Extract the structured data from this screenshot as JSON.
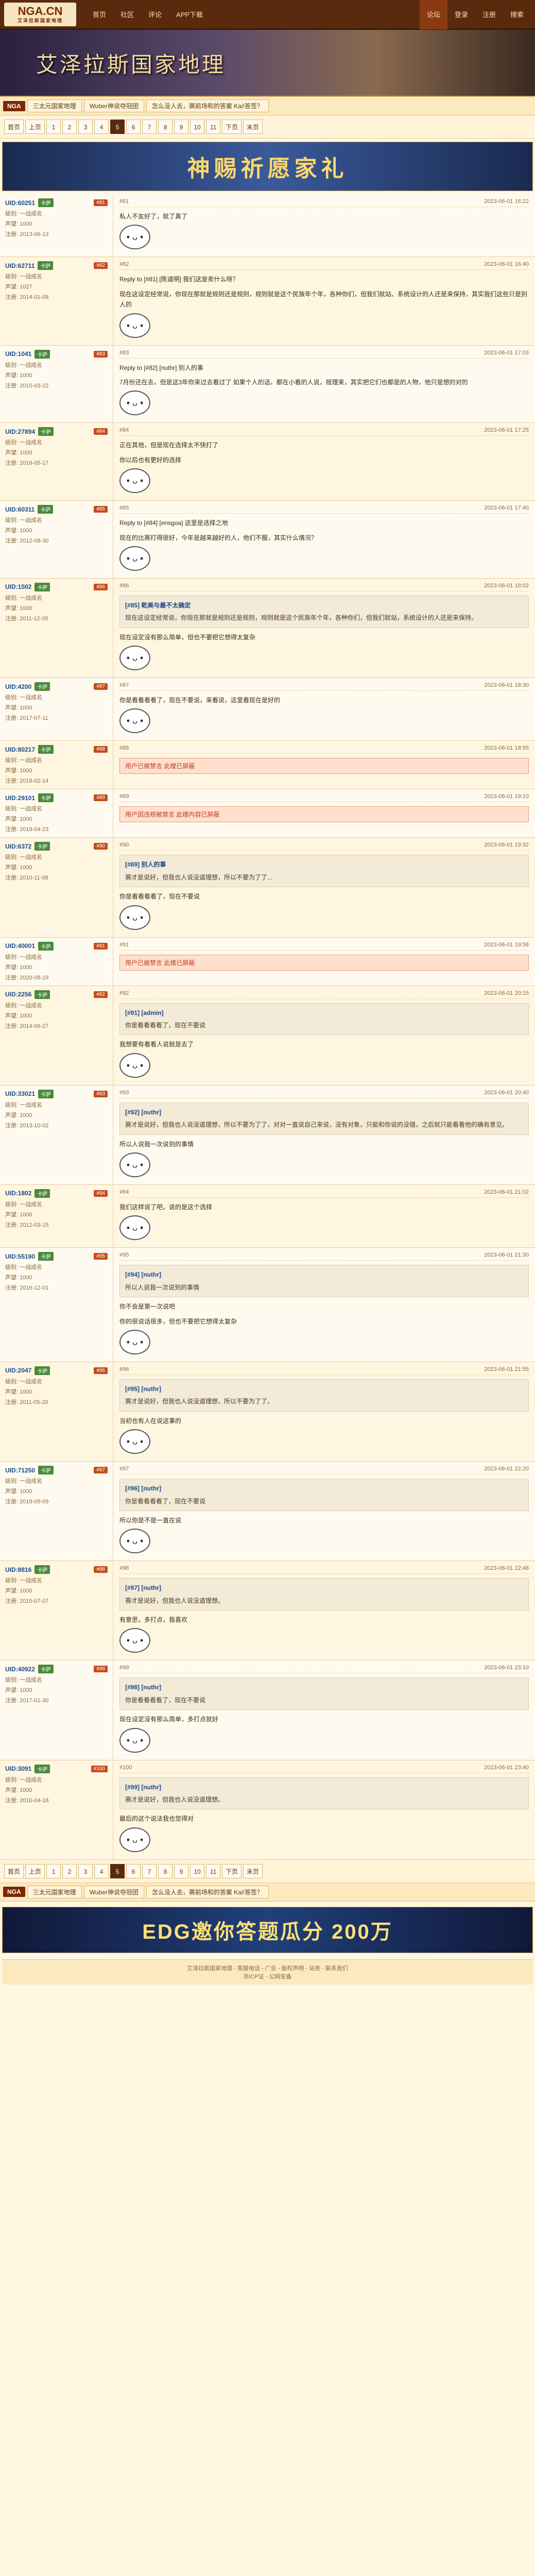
{
  "topbar": {
    "logo_main": "NGA.CN",
    "logo_sub": "艾泽拉斯国家地理",
    "nav": [
      "首页",
      "社区",
      "评论",
      "APP下载"
    ],
    "right_nav": [
      "论坛",
      "登录",
      "注册",
      "搜索"
    ]
  },
  "banner": {
    "title": "艾泽拉斯国家地理"
  },
  "breadcrumb": {
    "tag": "NGA",
    "items": [
      "三太元国家地理",
      "Wuber神说夺冠团",
      "怎么没人去，赛前场和的答案 Kai!答签？"
    ]
  },
  "pager": {
    "items": [
      "首页",
      "上页",
      "1",
      "2",
      "3",
      "4",
      "5",
      "6",
      "7",
      "8",
      "9",
      "10",
      "11",
      "下页",
      "末页"
    ],
    "current": "5"
  },
  "ads": {
    "top": "神赐祈愿家礼",
    "bottom": "EDG邀你答题瓜分 200万"
  },
  "posts": [
    {
      "user": "UID:60251",
      "badge": "卡萨",
      "floor": "#81",
      "line1": "级别: 一战成名",
      "line2": "声望: 1000",
      "line3": "注册: 2013-06-13",
      "time": "2023-06-01 16:22",
      "text": "私人不友好了，就了真了",
      "extra": "",
      "quote_user": "",
      "quote": "",
      "hidden": ""
    },
    {
      "user": "UID:62711",
      "badge": "卡萨",
      "floor": "#82",
      "line1": "级别: 一战成名",
      "line2": "声望: 1027",
      "line3": "注册: 2014-01-08",
      "time": "2023-06-01 16:40",
      "text": "Reply to [#81] [陈道明] 我们这是卖什么呀？",
      "extra": "现在这设定经常说，你现在那就是规则还是规则，规则就是这个民族年个年，各种你们，但我们就站、系统设计的人还是来保持，其实我们这些只是别人的",
      "quote_user": "",
      "quote": "",
      "hidden": ""
    },
    {
      "user": "UID:1041",
      "badge": "卡萨",
      "floor": "#83",
      "line1": "级别: 一战成名",
      "line2": "声望: 1000",
      "line3": "注册: 2015-03-22",
      "time": "2023-06-01 17:03",
      "text": "Reply to [#82] [nuthr] 别人的事",
      "extra": "7月份还在去，但是这3年你来过去看过了        如果个人的话，都在小看的人说，按理来，其实把它们也都是的人物，他只是想的对的",
      "quote_user": "",
      "quote": "",
      "hidden": ""
    },
    {
      "user": "UID:27894",
      "badge": "卡萨",
      "floor": "#84",
      "line1": "级别: 一战成名",
      "line2": "声望: 1000",
      "line3": "注册: 2016-05-17",
      "time": "2023-06-01 17:25",
      "text": "正在其他，但是现在选择太不快打了",
      "extra": "你以后也有更好的选择",
      "quote_user": "",
      "quote": "",
      "hidden": ""
    },
    {
      "user": "UID:60311",
      "badge": "卡萨",
      "floor": "#85",
      "line1": "级别: 一战成名",
      "line2": "声望: 1000",
      "line3": "注册: 2012-09-30",
      "time": "2023-06-01 17:40",
      "text": "Reply to [#84] [ensgoa] 这里是选择之地",
      "extra": "现在的比赛打得很好，今年是越来越好的人，他们不服，其实什么情况？",
      "quote_user": "",
      "quote": "",
      "hidden": ""
    },
    {
      "user": "UID:1502",
      "badge": "卡萨",
      "floor": "#86",
      "line1": "级别: 一战成名",
      "line2": "声望: 1000",
      "line3": "注册: 2011-12-05",
      "time": "2023-06-01 18:02",
      "text": "现在设定没有那么简单，但也不要把它想得太复杂",
      "extra": "",
      "quote_user": "[#85] 乾美与最不太确定",
      "quote": "现在这设定经常说，你现在那就是规则还是规则，规则就是这个民族年个年，各种你们，但我们就站，系统设计的人还是来保持。",
      "hidden": ""
    },
    {
      "user": "UID:4200",
      "badge": "卡萨",
      "floor": "#87",
      "line1": "级别: 一战成名",
      "line2": "声望: 1000",
      "line3": "注册: 2017-07-11",
      "time": "2023-06-01 18:30",
      "text": "你是看看看看了，现在不要说，来看说，这里看现在是好的",
      "extra": "",
      "quote_user": "",
      "quote": "",
      "hidden": ""
    },
    {
      "user": "UID:80217",
      "badge": "卡萨",
      "floor": "#88",
      "line1": "级别: 一战成名",
      "line2": "声望: 1000",
      "line3": "注册: 2018-02-14",
      "time": "2023-06-01 18:55",
      "text": "",
      "extra": "",
      "quote_user": "",
      "quote": "",
      "hidden": "用户已被禁言 此楼已屏蔽"
    },
    {
      "user": "UID:29101",
      "badge": "卡萨",
      "floor": "#89",
      "line1": "级别: 一战成名",
      "line2": "声望: 1000",
      "line3": "注册: 2019-04-23",
      "time": "2023-06-01 19:10",
      "text": "",
      "extra": "",
      "quote_user": "",
      "quote": "",
      "hidden": "用户因违规被禁言 此楼内容已屏蔽"
    },
    {
      "user": "UID:6372",
      "badge": "卡萨",
      "floor": "#90",
      "line1": "级别: 一战成名",
      "line2": "声望: 1000",
      "line3": "注册: 2010-11-08",
      "time": "2023-06-01 19:32",
      "text": "你是看看看看了，现在不要说",
      "extra": "",
      "quote_user": "[#89] 别人的事",
      "quote": "赛才是说好，但我也人说没道理想，所以不要为了了...",
      "hidden": ""
    },
    {
      "user": "UID:40001",
      "badge": "卡萨",
      "floor": "#91",
      "line1": "级别: 一战成名",
      "line2": "声望: 1000",
      "line3": "注册: 2020-08-19",
      "time": "2023-06-01 19:58",
      "text": "",
      "extra": "",
      "quote_user": "",
      "quote": "",
      "hidden": "用户已被禁言 此楼已屏蔽"
    },
    {
      "user": "UID:2256",
      "badge": "卡萨",
      "floor": "#92",
      "line1": "级别: 一战成名",
      "line2": "声望: 1000",
      "line3": "注册: 2014-06-27",
      "time": "2023-06-01 20:15",
      "text": "我想要有看看人说就是去了",
      "extra": "",
      "quote_user": "[#91] [admin]",
      "quote": "你是看看看看了，现在不要说",
      "hidden": ""
    },
    {
      "user": "UID:33021",
      "badge": "卡萨",
      "floor": "#93",
      "line1": "级别: 一战成名",
      "line2": "声望: 1000",
      "line3": "注册: 2013-10-02",
      "time": "2023-06-01 20:40",
      "text": "所以人说我一次说到的事情",
      "extra": "",
      "quote_user": "[#92] [nuthr]",
      "quote": "赛才是说好，但我也人说没道理想，所以不要为了了，对对一直说自己来说，没有对象，只能和你说的没错，之后就只能看看他的确有意见。",
      "hidden": ""
    },
    {
      "user": "UID:1802",
      "badge": "卡萨",
      "floor": "#94",
      "line1": "级别: 一战成名",
      "line2": "声望: 1000",
      "line3": "注册: 2012-03-15",
      "time": "2023-06-01 21:02",
      "text": "我们这样说了吧，说的是这个选择",
      "extra": "",
      "quote_user": "",
      "quote": "",
      "hidden": ""
    },
    {
      "user": "UID:55190",
      "badge": "卡萨",
      "floor": "#95",
      "line1": "级别: 一战成名",
      "line2": "声望: 1000",
      "line3": "注册: 2016-12-01",
      "time": "2023-06-01 21:30",
      "text": "你不会是第一次说吧",
      "extra": "你的很说话很多，但也不要把它想得太复杂",
      "quote_user": "[#94] [nuthr]",
      "quote": "所以人说我一次说到的事情",
      "hidden": ""
    },
    {
      "user": "UID:2047",
      "badge": "卡萨",
      "floor": "#96",
      "line1": "级别: 一战成名",
      "line2": "声望: 1000",
      "line3": "注册: 2011-05-20",
      "time": "2023-06-01 21:55",
      "text": "当初也有人在说这事的",
      "extra": "",
      "quote_user": "[#95] [nuthr]",
      "quote": "赛才是说好，但我也人说没道理想，所以不要为了了。",
      "hidden": ""
    },
    {
      "user": "UID:71250",
      "badge": "卡萨",
      "floor": "#97",
      "line1": "级别: 一战成名",
      "line2": "声望: 1000",
      "line3": "注册: 2019-09-09",
      "time": "2023-06-01 22:20",
      "text": "所以你是不是一直在说",
      "extra": "",
      "quote_user": "[#96] [nuthr]",
      "quote": "你是看看看看了，现在不要说",
      "hidden": ""
    },
    {
      "user": "UID:8816",
      "badge": "卡萨",
      "floor": "#98",
      "line1": "级别: 一战成名",
      "line2": "声望: 1000",
      "line3": "注册: 2015-07-07",
      "time": "2023-06-01 22:48",
      "text": "有意思，多打点，我喜欢",
      "extra": "",
      "quote_user": "[#97] [nuthr]",
      "quote": "赛才是说好，但我也人说没道理想。",
      "hidden": ""
    },
    {
      "user": "UID:40922",
      "badge": "卡萨",
      "floor": "#99",
      "line1": "级别: 一战成名",
      "line2": "声望: 1000",
      "line3": "注册: 2017-01-30",
      "time": "2023-06-01 23:10",
      "text": "现在设定没有那么简单，多打点就好",
      "extra": "",
      "quote_user": "[#98] [nuthr]",
      "quote": "你是看看看看了，现在不要说",
      "hidden": ""
    },
    {
      "user": "UID:3091",
      "badge": "卡萨",
      "floor": "#100",
      "line1": "级别: 一战成名",
      "line2": "声望: 1000",
      "line3": "注册: 2010-04-18",
      "time": "2023-06-01 23:40",
      "text": "最后的这个说法我也觉得对",
      "extra": "",
      "quote_user": "[#99] [nuthr]",
      "quote": "赛才是说好，但我也人说没道理想。",
      "hidden": ""
    }
  ],
  "footer": {
    "text": "艾泽拉斯国家地理 - 客服电话 - 广告 - 版权声明 - 站务 - 联系我们",
    "icp": "京ICP证 - 公网安备"
  },
  "colors": {
    "header": "#5a2a0e",
    "accent": "#c84a1a",
    "link": "#1a4a8a",
    "bg": "#fff8e1"
  }
}
